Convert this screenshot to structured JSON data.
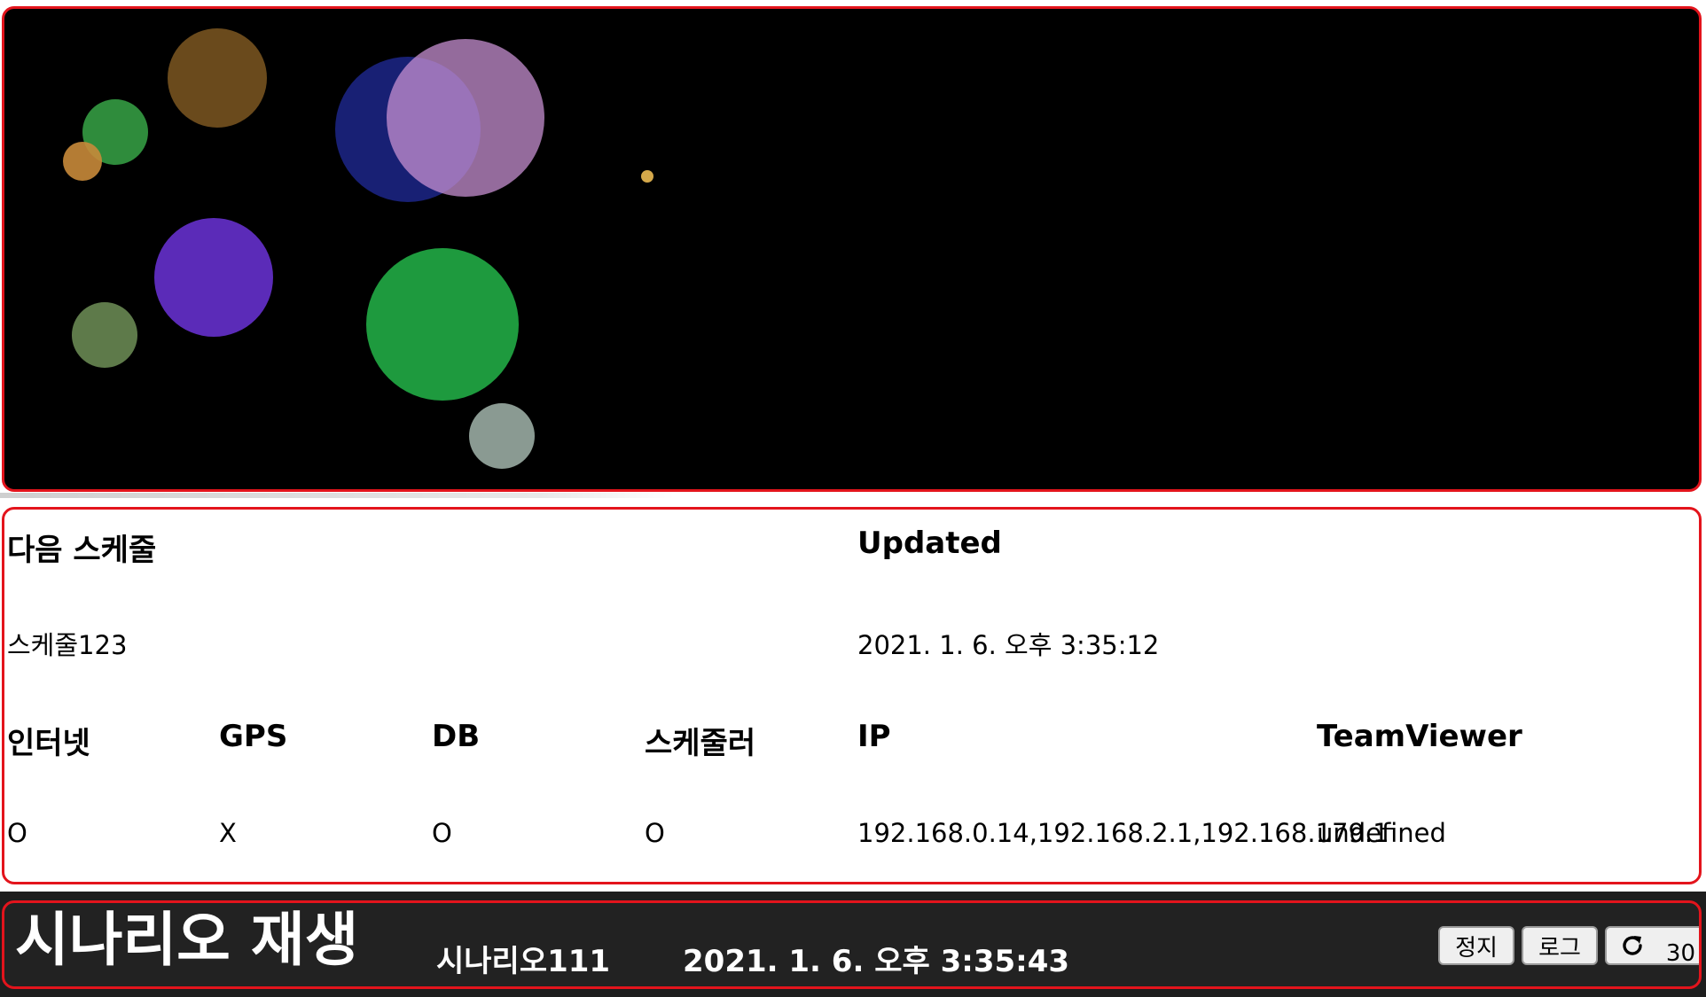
{
  "circles": [
    {
      "color": "#6a4a1c",
      "opacity": 1
    },
    {
      "color": "#2f8c3c",
      "opacity": 1
    },
    {
      "color": "#c8893a",
      "opacity": 0.9
    },
    {
      "color": "#1a237e",
      "opacity": 0.92
    },
    {
      "color": "#c68fd0",
      "opacity": 0.75
    },
    {
      "color": "#d4a84a",
      "opacity": 1
    },
    {
      "color": "#5b2bb8",
      "opacity": 1
    },
    {
      "color": "#5e7a4a",
      "opacity": 1
    },
    {
      "color": "#1e9a3e",
      "opacity": 1
    },
    {
      "color": "#8a9a92",
      "opacity": 1
    }
  ],
  "status": {
    "next_schedule_label": "다음 스케줄",
    "next_schedule_value": "스케줄123",
    "updated_label": "Updated",
    "updated_value": "2021. 1. 6. 오후 3:35:12",
    "columns": [
      {
        "label": "인터넷",
        "value": "O"
      },
      {
        "label": "GPS",
        "value": "X"
      },
      {
        "label": "DB",
        "value": "O"
      },
      {
        "label": "스케줄러",
        "value": "O"
      },
      {
        "label": "IP",
        "value": "192.168.0.14,192.168.2.1,192.168.179.1"
      },
      {
        "label": "TeamViewer",
        "value": "undefined"
      }
    ]
  },
  "footer": {
    "title": "시나리오 재생",
    "scenario_name": "시나리오111",
    "datetime": "2021. 1. 6. 오후 3:35:43",
    "stop_label": "정지",
    "log_label": "로그",
    "refresh_icon": "refresh-icon",
    "refresh_count": "30"
  },
  "colors": {
    "panel_border": "#e3141c",
    "canvas_bg": "#000000",
    "footer_bg": "#222222"
  }
}
